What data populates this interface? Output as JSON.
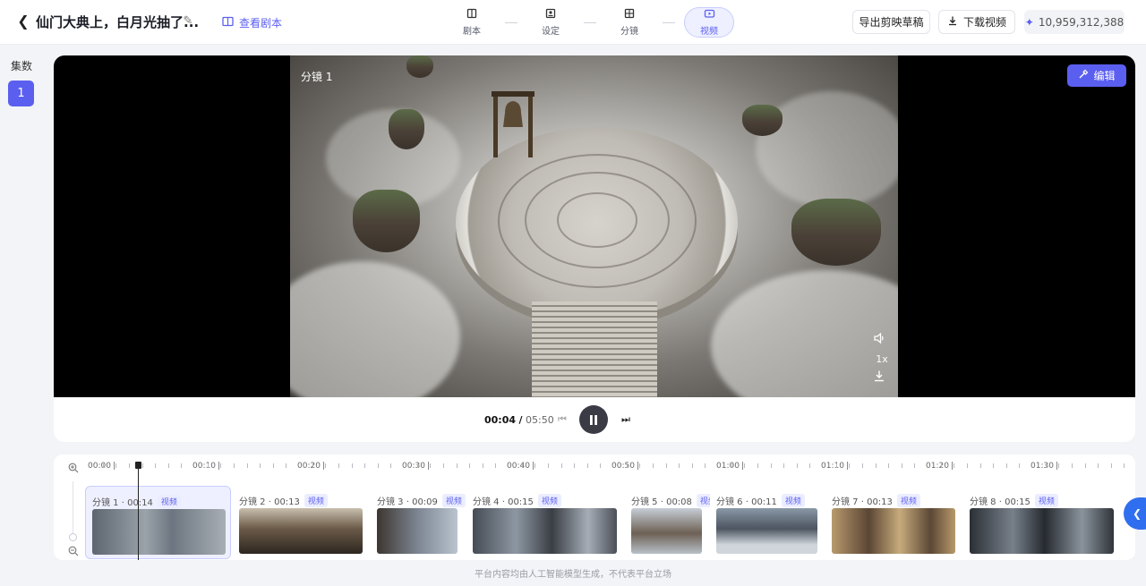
{
  "header": {
    "title": "仙门大典上，白月光抽了...",
    "view_script": "查看剧本",
    "steps": [
      {
        "label": "剧本",
        "icon": "book-icon"
      },
      {
        "label": "设定",
        "icon": "settings-card-icon"
      },
      {
        "label": "分镜",
        "icon": "storyboard-icon"
      },
      {
        "label": "视频",
        "icon": "video-icon"
      }
    ],
    "active_step": "视频",
    "export_draft": "导出剪映草稿",
    "download_video": "下载视频",
    "credits": "10,959,312,388"
  },
  "sidebar": {
    "label": "集数",
    "episodes": [
      "1"
    ]
  },
  "player": {
    "frame_label": "分镜 1",
    "edit_label": "编辑",
    "speed": "1x",
    "current_time": "00:04",
    "separator": "/",
    "total_time": "05:50"
  },
  "timeline": {
    "ruler_labels": [
      "00:00",
      "00:10",
      "00:20",
      "00:30",
      "00:40",
      "00:50",
      "01:00",
      "01:10",
      "01:20",
      "01:30"
    ],
    "clips": [
      {
        "name": "分镜 1 · 00:14",
        "badge": "视频"
      },
      {
        "name": "分镜 2 · 00:13",
        "badge": "视频"
      },
      {
        "name": "分镜 3 · 00:09",
        "badge": "视频"
      },
      {
        "name": "分镜 4 · 00:15",
        "badge": "视频"
      },
      {
        "name": "分镜 5 · 00:08",
        "badge": "视频"
      },
      {
        "name": "分镜 6 · 00:11",
        "badge": "视频"
      },
      {
        "name": "分镜 7 · 00:13",
        "badge": "视频"
      },
      {
        "name": "分镜 8 · 00:15",
        "badge": "视频"
      }
    ]
  },
  "footer": "平台内容均由人工智能模型生成，不代表平台立场",
  "colors": {
    "accent": "#5b5ff0",
    "collapse": "#2f6fef"
  }
}
